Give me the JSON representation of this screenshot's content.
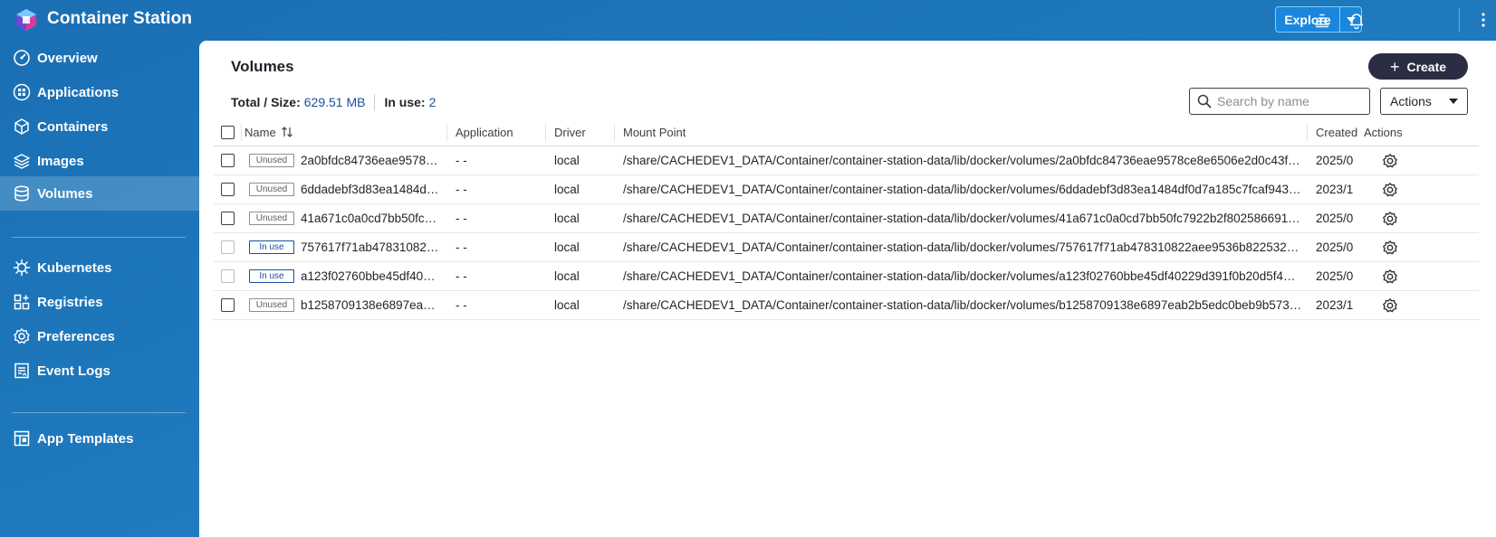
{
  "app": {
    "title": "Container Station"
  },
  "topbar": {
    "explore_label": "Explore"
  },
  "sidebar": {
    "items": [
      {
        "label": "Overview",
        "icon": "gauge-icon"
      },
      {
        "label": "Applications",
        "icon": "applications-icon"
      },
      {
        "label": "Containers",
        "icon": "cube-icon"
      },
      {
        "label": "Images",
        "icon": "layers-icon"
      },
      {
        "label": "Volumes",
        "icon": "database-icon",
        "active": true
      },
      {
        "label": "Kubernetes",
        "icon": "helm-icon"
      },
      {
        "label": "Registries",
        "icon": "registry-icon"
      },
      {
        "label": "Preferences",
        "icon": "gear-icon"
      },
      {
        "label": "Event Logs",
        "icon": "log-icon"
      },
      {
        "label": "App Templates",
        "icon": "template-icon"
      }
    ]
  },
  "main": {
    "title": "Volumes",
    "create_label": "Create",
    "summary": {
      "total_label": "Total / Size:",
      "total_value": "629.51 MB",
      "inuse_label": "In use:",
      "inuse_value": "2"
    },
    "search": {
      "placeholder": "Search by name"
    },
    "actions_label": "Actions",
    "columns": [
      "Name",
      "Application",
      "Driver",
      "Mount Point",
      "Created",
      "Actions"
    ],
    "rows": [
      {
        "status": "Unused",
        "name": "2a0bfdc84736eae9578…",
        "application": "- -",
        "driver": "local",
        "mount": "/share/CACHEDEV1_DATA/Container/container-station-data/lib/docker/volumes/2a0bfdc84736eae9578ce8e6506e2d0c43f…",
        "created": "2025/0"
      },
      {
        "status": "Unused",
        "name": "6ddadebf3d83ea1484df…",
        "application": "- -",
        "driver": "local",
        "mount": "/share/CACHEDEV1_DATA/Container/container-station-data/lib/docker/volumes/6ddadebf3d83ea1484df0d7a185c7fcaf943…",
        "created": "2023/1"
      },
      {
        "status": "Unused",
        "name": "41a671c0a0cd7bb50fc…",
        "application": "- -",
        "driver": "local",
        "mount": "/share/CACHEDEV1_DATA/Container/container-station-data/lib/docker/volumes/41a671c0a0cd7bb50fc7922b2f802586691…",
        "created": "2025/0"
      },
      {
        "status": "In use",
        "name": "757617f71ab47831082…",
        "application": "- -",
        "driver": "local",
        "mount": "/share/CACHEDEV1_DATA/Container/container-station-data/lib/docker/volumes/757617f71ab478310822aee9536b822532…",
        "created": "2025/0"
      },
      {
        "status": "In use",
        "name": "a123f02760bbe45df402…",
        "application": "- -",
        "driver": "local",
        "mount": "/share/CACHEDEV1_DATA/Container/container-station-data/lib/docker/volumes/a123f02760bbe45df40229d391f0b20d5f4…",
        "created": "2025/0"
      },
      {
        "status": "Unused",
        "name": "b1258709138e6897eab…",
        "application": "- -",
        "driver": "local",
        "mount": "/share/CACHEDEV1_DATA/Container/container-station-data/lib/docker/volumes/b1258709138e6897eab2b5edc0beb9b573…",
        "created": "2023/1"
      }
    ]
  },
  "colors": {
    "accent": "#1a4f9c",
    "sidebar_bg": "#1e77bb",
    "create_bg": "#2b2d42"
  }
}
